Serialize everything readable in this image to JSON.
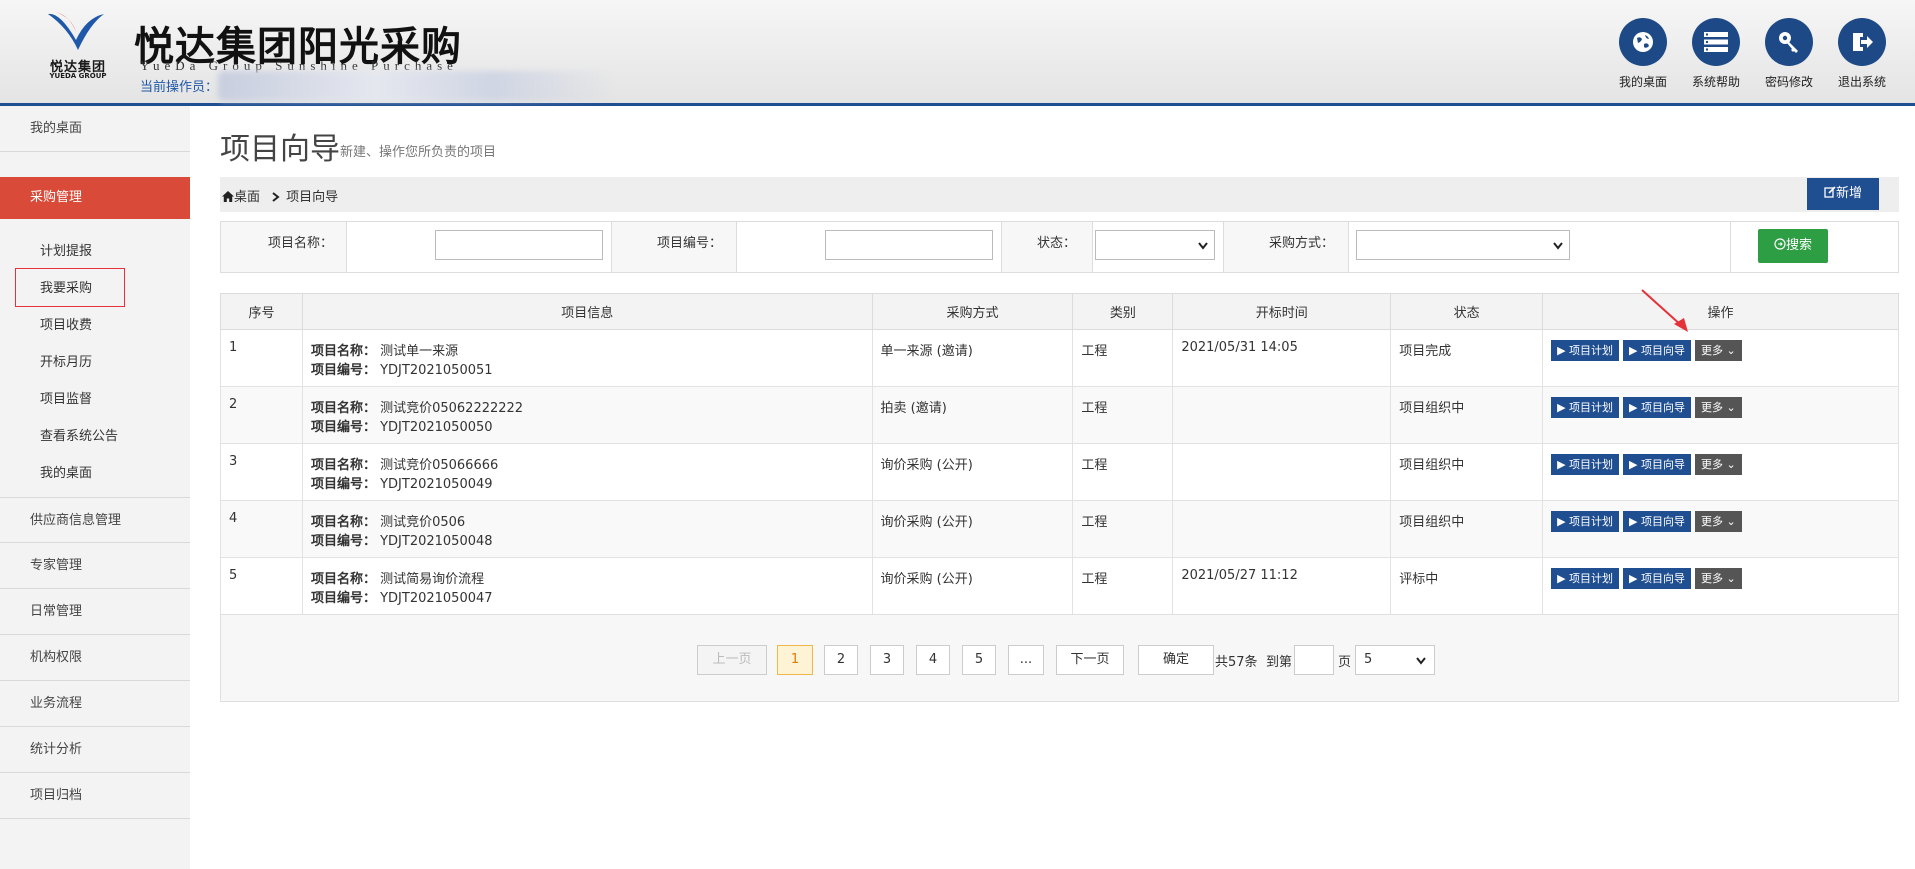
{
  "header": {
    "logo_cn": "悦达集团",
    "logo_en": "YUEDA GROUP",
    "title": "悦达集团阳光采购",
    "subtitle": "YueDa Group Sunshine Purchase",
    "operator_label": "当前操作员：",
    "buttons": [
      {
        "label": "我的桌面",
        "icon": "globe-icon"
      },
      {
        "label": "系统帮助",
        "icon": "server-icon"
      },
      {
        "label": "密码修改",
        "icon": "key-icon"
      },
      {
        "label": "退出系统",
        "icon": "logout-icon"
      }
    ]
  },
  "sidebar": {
    "items": [
      "我的桌面",
      "采购管理",
      "供应商信息管理",
      "专家管理",
      "日常管理",
      "机构权限",
      "业务流程",
      "统计分析",
      "项目归档"
    ],
    "subitems": [
      "计划提报",
      "我要采购",
      "项目收费",
      "开标月历",
      "项目监督",
      "查看系统公告",
      "我的桌面"
    ]
  },
  "page": {
    "title": "项目向导",
    "subtitle": "新建、操作您所负责的项目"
  },
  "breadcrumb": {
    "home": "桌面",
    "current": "项目向导"
  },
  "add_button": "新增",
  "search": {
    "name_label": "项目名称：",
    "code_label": "项目编号：",
    "status_label": "状态：",
    "method_label": "采购方式：",
    "button": "搜索"
  },
  "table": {
    "headers": [
      "序号",
      "项目信息",
      "采购方式",
      "类别",
      "开标时间",
      "状态",
      "操作"
    ],
    "name_label": "项目名称：",
    "code_label": "项目编号：",
    "op_plan": "项目计划",
    "op_guide": "项目向导",
    "op_more": "更多",
    "rows": [
      {
        "no": "1",
        "name": "测试单一来源",
        "code": "YDJT2021050051",
        "method": "单一来源 (邀请)",
        "category": "工程",
        "time": "2021/05/31 14:05",
        "status": "项目完成"
      },
      {
        "no": "2",
        "name": "测试竞价05062222222",
        "code": "YDJT2021050050",
        "method": "拍卖 (邀请)",
        "category": "工程",
        "time": "",
        "status": "项目组织中"
      },
      {
        "no": "3",
        "name": "测试竞价05066666",
        "code": "YDJT2021050049",
        "method": "询价采购 (公开)",
        "category": "工程",
        "time": "",
        "status": "项目组织中"
      },
      {
        "no": "4",
        "name": "测试竞价0506",
        "code": "YDJT2021050048",
        "method": "询价采购 (公开)",
        "category": "工程",
        "time": "",
        "status": "项目组织中"
      },
      {
        "no": "5",
        "name": "测试简易询价流程",
        "code": "YDJT2021050047",
        "method": "询价采购 (公开)",
        "category": "工程",
        "time": "2021/05/27 11:12",
        "status": "评标中"
      }
    ]
  },
  "pager": {
    "prev": "上一页",
    "pages": [
      "1",
      "2",
      "3",
      "4",
      "5",
      "..."
    ],
    "next": "下一页",
    "confirm": "确定",
    "total": "共57条",
    "goto": "到第",
    "page_unit": "页",
    "page_size": "5"
  },
  "colors": {
    "brand_blue": "#1f4e91",
    "active_red": "#d94a38",
    "search_green": "#2e9e45"
  }
}
